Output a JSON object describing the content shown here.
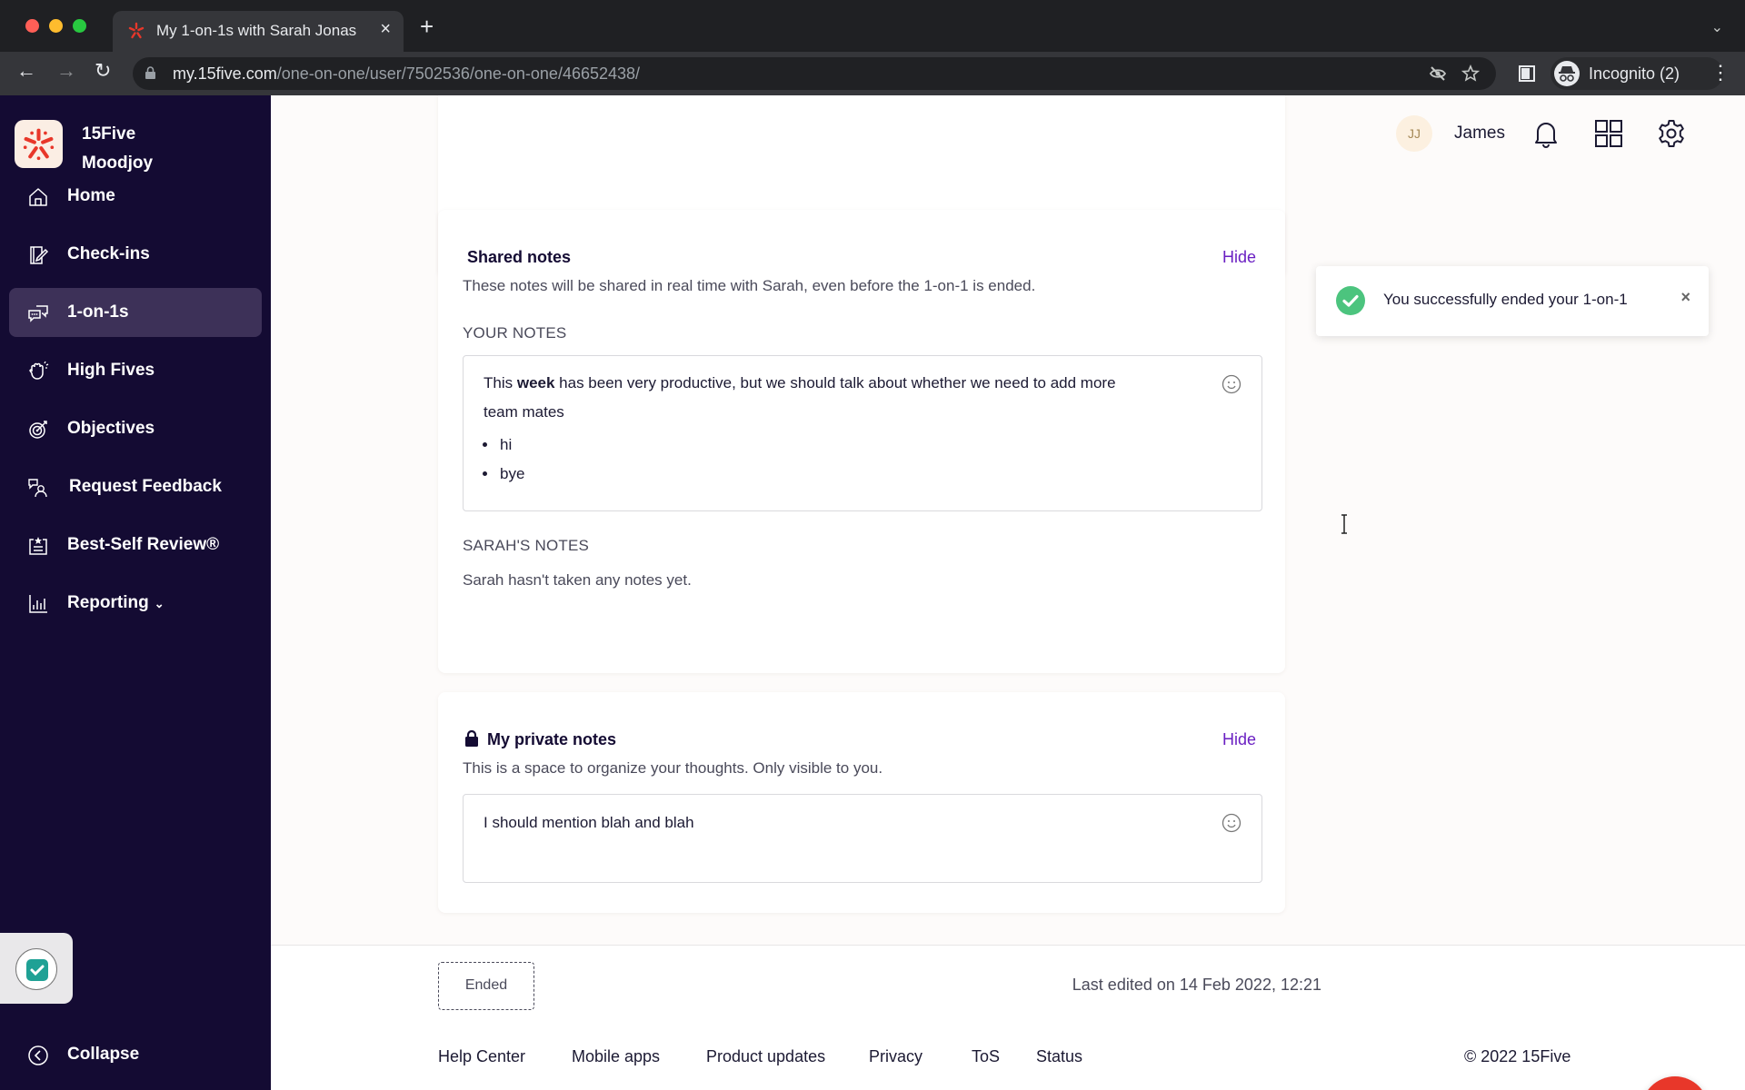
{
  "browser": {
    "tab_title": "My 1-on-1s with Sarah Jonas",
    "url_host": "my.15five.com",
    "url_path": "/one-on-one/user/7502536/one-on-one/46652438/",
    "profile_label": "Incognito (2)"
  },
  "sidebar": {
    "company": "15Five",
    "workspace": "Moodjoy",
    "items": [
      {
        "label": "Home",
        "icon": "home-icon"
      },
      {
        "label": "Check-ins",
        "icon": "check-ins-icon"
      },
      {
        "label": "1-on-1s",
        "icon": "chat-bubbles-icon",
        "active": true
      },
      {
        "label": "High Fives",
        "icon": "high-five-hand-icon"
      },
      {
        "label": "Objectives",
        "icon": "target-icon"
      },
      {
        "label": "Request Feedback",
        "icon": "feedback-person-icon"
      },
      {
        "label": "Best-Self Review®",
        "icon": "review-clipboard-icon"
      },
      {
        "label": "Reporting",
        "icon": "bar-chart-icon",
        "has_dropdown": true
      }
    ],
    "collapse_label": "Collapse"
  },
  "header": {
    "user_initials": "JJ",
    "user_name": "James"
  },
  "shared_notes": {
    "title": "Shared notes",
    "hide_label": "Hide",
    "description": "These notes will be shared in real time with Sarah, even before the 1-on-1 is ended.",
    "your_notes_label": "YOUR NOTES",
    "your_notes_text_before_bold": "This ",
    "your_notes_bold": "week",
    "your_notes_text_after_bold": " has been very productive, but we should talk about whether we need to add more team mates",
    "your_notes_bullets": [
      "hi",
      "bye"
    ],
    "sarah_notes_label": "SARAH'S NOTES",
    "sarah_notes_empty": "Sarah hasn't taken any notes yet."
  },
  "private_notes": {
    "title": "My private notes",
    "hide_label": "Hide",
    "description": "This is a space to organize your thoughts. Only visible to you.",
    "text": "I should mention blah and blah"
  },
  "toast": {
    "message": "You successfully ended your 1-on-1",
    "status": "success"
  },
  "status_bar": {
    "status_badge": "Ended",
    "last_edited": "Last edited on 14 Feb 2022, 12:21"
  },
  "footer": {
    "links": [
      "Help Center",
      "Mobile apps",
      "Product updates",
      "Privacy",
      "ToS",
      "Status"
    ],
    "copyright": "© 2022 15Five"
  },
  "colors": {
    "sidebar_bg": "#140b33",
    "active_item_bg": "#3d3158",
    "link_purple": "#6a1fc2",
    "success_green": "#4cc47e",
    "brand_red": "#e8372a"
  }
}
